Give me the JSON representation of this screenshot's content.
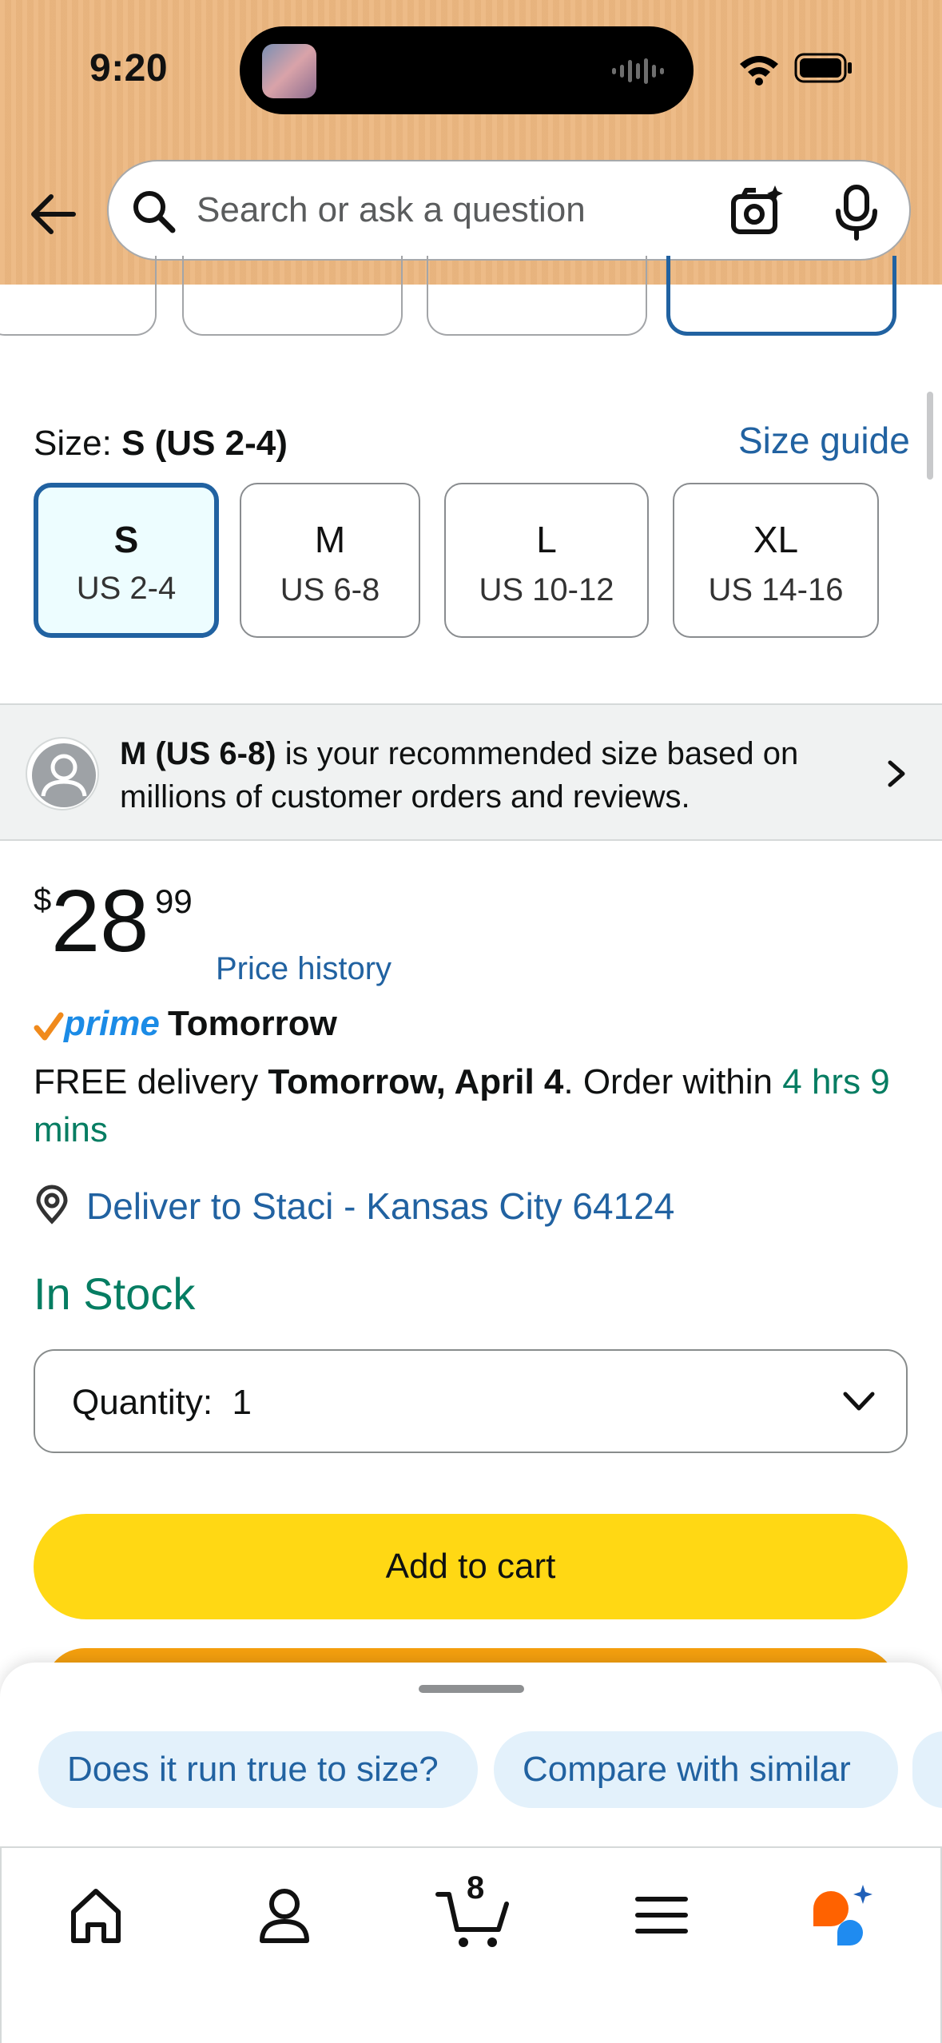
{
  "status_bar": {
    "time": "9:20"
  },
  "search": {
    "placeholder": "Search or ask a question"
  },
  "size": {
    "label_prefix": "Size:",
    "selected_value": "S (US 2-4)",
    "guide_link": "Size guide",
    "options": [
      {
        "code": "S",
        "us": "US 2-4",
        "selected": true
      },
      {
        "code": "M",
        "us": "US 6-8",
        "selected": false
      },
      {
        "code": "L",
        "us": "US 10-12",
        "selected": false
      },
      {
        "code": "XL",
        "us": "US 14-16",
        "selected": false
      }
    ]
  },
  "recommendation": {
    "size": "M (US 6-8)",
    "text": " is your recommended size based on millions of customer orders and reviews."
  },
  "price": {
    "symbol": "$",
    "whole": "28",
    "fraction": "99",
    "history_link": "Price history"
  },
  "prime": {
    "brand": "prime",
    "label": "Tomorrow"
  },
  "delivery": {
    "prefix": "FREE delivery ",
    "date": "Tomorrow, April 4",
    "middle": ". Order within ",
    "countdown": "4 hrs 9 mins"
  },
  "location": {
    "text": "Deliver to Staci - Kansas City 64124"
  },
  "stock": {
    "status": "In Stock"
  },
  "quantity": {
    "label": "Quantity:",
    "value": "1"
  },
  "actions": {
    "add_to_cart": "Add to cart"
  },
  "suggestions": [
    "Does it run true to size?",
    "Compare with similar"
  ],
  "nav": {
    "cart_count": "8",
    "items": [
      "home-icon",
      "account-icon",
      "cart-icon",
      "menu-icon",
      "rufus-ai-icon"
    ]
  },
  "colors": {
    "header_bg": "#ecb780",
    "link_blue": "#2162a1",
    "stock_green": "#067d62",
    "add_to_cart_yellow": "#ffd814",
    "buy_now_orange": "#f5a00e"
  }
}
